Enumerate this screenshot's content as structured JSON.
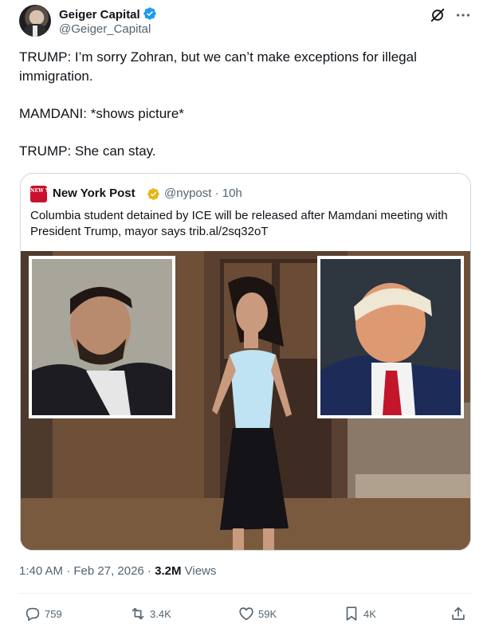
{
  "author": {
    "display_name": "Geiger Capital",
    "handle": "@Geiger_Capital",
    "verified_color": "#1d9bf0"
  },
  "header_icons": [
    "grok-icon",
    "more-icon"
  ],
  "tweet": {
    "paragraph_1": "TRUMP: I’m sorry Zohran, but we can’t make exceptions for illegal immigration.",
    "paragraph_2": "MAMDANI: *shows picture*",
    "paragraph_3": "TRUMP: She can stay."
  },
  "quote": {
    "logo_text": "NEW YORK POST",
    "name": "New York Post",
    "verified_color": "#e2b719",
    "handle_time": "@nypost · 10h",
    "text": "Columbia student detained by ICE will be released after Mamdani meeting with President Trump, mayor says trib.al/2sq32oT"
  },
  "meta": {
    "time_date": "1:40 AM · Feb 27, 2026 · ",
    "views_count": "3.2M",
    "views_label": " Views"
  },
  "actions": {
    "replies": "759",
    "reposts": "3.4K",
    "likes": "59K",
    "bookmarks": "4K"
  },
  "colors": {
    "text": "#0f1419",
    "secondary": "#536471",
    "border": "#cfd9de",
    "nypost_red": "#c8102e"
  }
}
